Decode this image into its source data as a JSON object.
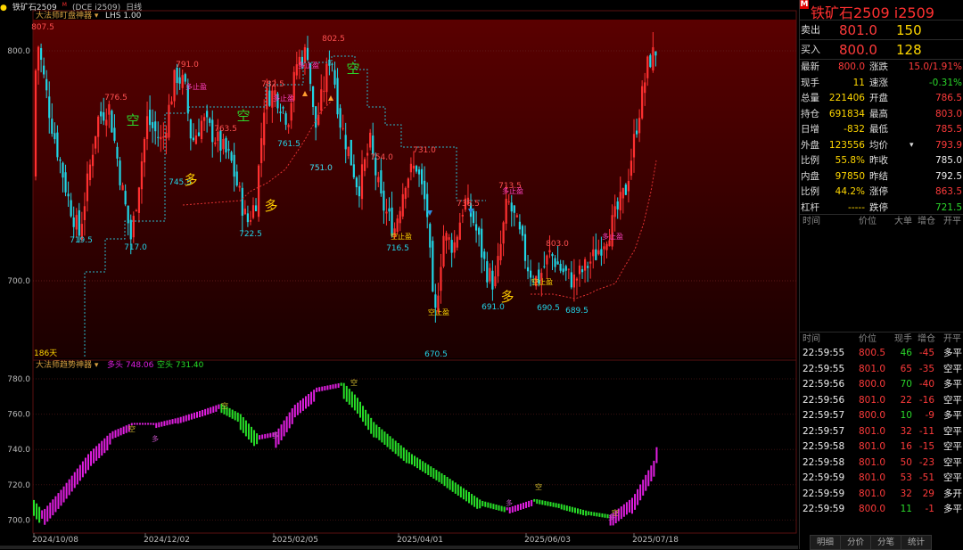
{
  "header": {
    "symbol_label": "铁矿石2509",
    "symbol_sup": "M",
    "code": "(DCE i2509)",
    "period": "日线"
  },
  "main_chart": {
    "indicator": "大法师盯盘神器",
    "extra": "LHS 1.00",
    "y_labels": [
      "800.0",
      "700.0"
    ],
    "annotations": {
      "highs": [
        "807.5",
        "791.0",
        "776.5",
        "763.5",
        "782.5",
        "802.5",
        "751.0",
        "754.0",
        "731.0",
        "738.5",
        "713.5",
        "803.0"
      ],
      "lows": [
        "719.5",
        "717.0",
        "745.5",
        "722.5",
        "761.5",
        "751.0",
        "716.5",
        "670.5",
        "691.0",
        "690.5",
        "689.5"
      ],
      "signals": [
        "空",
        "空",
        "空",
        "多",
        "多",
        "多"
      ],
      "stop_labels": [
        "多止盈",
        "多止盈",
        "多止盈",
        "空止盈",
        "空止盈",
        "空止盈",
        "多止盈",
        "多止盈"
      ],
      "corner": "186天"
    },
    "colors": {
      "up": "#ff3030",
      "down": "#1fd6e6",
      "bg_top": "#5a0000"
    }
  },
  "sub_chart": {
    "indicator": "大法师趋势神器",
    "long_label": "多头",
    "long_value": "748.06",
    "short_label": "空头",
    "short_value": "731.40",
    "y_labels": [
      "780.0",
      "760.0",
      "740.0",
      "720.0",
      "700.0"
    ],
    "marks": [
      "空",
      "多",
      "空",
      "多",
      "空",
      "空",
      "多",
      "空",
      "多"
    ],
    "colors": {
      "long": "#e01ee0",
      "short": "#28e028"
    }
  },
  "x_axis": [
    "2024/10/08",
    "2024/12/02",
    "2025/02/05",
    "2025/04/01",
    "2025/06/03",
    "2025/07/18"
  ],
  "chart_data": {
    "type": "candlestick",
    "title": "铁矿石2509 (DCE i2509) 日线",
    "xlabel": "",
    "ylabel": "",
    "ylim": [
      660,
      815
    ],
    "key_points": [
      {
        "x": "2024/10/08",
        "y": 807.5
      },
      {
        "x": "2024/10 end",
        "y": 719.5
      },
      {
        "x": "2024/11",
        "y": 776.5
      },
      {
        "x": "2024/11",
        "y": 717.0
      },
      {
        "x": "2024/12/02",
        "y": 791.0
      },
      {
        "x": "2024/12",
        "y": 745.5
      },
      {
        "x": "2024/12",
        "y": 763.5
      },
      {
        "x": "2025/01",
        "y": 722.5
      },
      {
        "x": "2025/01",
        "y": 782.5
      },
      {
        "x": "2025/01",
        "y": 761.5
      },
      {
        "x": "2025/02/05",
        "y": 802.5
      },
      {
        "x": "2025/02",
        "y": 751.0
      },
      {
        "x": "2025/03",
        "y": 751.0
      },
      {
        "x": "2025/03",
        "y": 716.5
      },
      {
        "x": "2025/03",
        "y": 754.0
      },
      {
        "x": "2025/04/01",
        "y": 670.5
      },
      {
        "x": "2025/04",
        "y": 731.0
      },
      {
        "x": "2025/05",
        "y": 691.0
      },
      {
        "x": "2025/05",
        "y": 738.5
      },
      {
        "x": "2025/06/03",
        "y": 690.5
      },
      {
        "x": "2025/06",
        "y": 713.5
      },
      {
        "x": "2025/06",
        "y": 689.5
      },
      {
        "x": "2025/07/18",
        "y": 803.0
      }
    ],
    "sub_indicator": {
      "long": 748.06,
      "short": 731.4,
      "ylim": [
        695,
        785
      ]
    }
  },
  "panel": {
    "title": "铁矿石2509  i2509",
    "badge": "M",
    "ask": {
      "label": "卖出",
      "price": "801.0",
      "vol": "150"
    },
    "bid": {
      "label": "买入",
      "price": "800.0",
      "vol": "128"
    },
    "stats": [
      {
        "l1": "最新",
        "v1": "800.0",
        "c1": "red",
        "l2": "涨跌",
        "v2": "15.0/1.91%",
        "c2": "red"
      },
      {
        "l1": "现手",
        "v1": "11",
        "c1": "yellow",
        "l2": "速涨",
        "v2": "-0.31%",
        "c2": "green"
      },
      {
        "l1": "总量",
        "v1": "221406",
        "c1": "yellow",
        "l2": "开盘",
        "v2": "786.5",
        "c2": "red"
      },
      {
        "l1": "持仓",
        "v1": "691834",
        "c1": "yellow",
        "l2": "最高",
        "v2": "803.0",
        "c2": "red"
      },
      {
        "l1": "日增",
        "v1": "-832",
        "c1": "yellow",
        "l2": "最低",
        "v2": "785.5",
        "c2": "red"
      },
      {
        "l1": "外盘",
        "v1": "123556",
        "c1": "yellow",
        "l2": "均价",
        "v2": "793.9",
        "c2": "red"
      },
      {
        "l1": "比例",
        "v1": "55.8%",
        "c1": "yellow",
        "l2": "昨收",
        "v2": "785.0",
        "c2": "white"
      },
      {
        "l1": "内盘",
        "v1": "97850",
        "c1": "yellow",
        "l2": "昨结",
        "v2": "792.5",
        "c2": "white"
      },
      {
        "l1": "比例",
        "v1": "44.2%",
        "c1": "yellow",
        "l2": "涨停",
        "v2": "863.5",
        "c2": "red"
      },
      {
        "l1": "杠杆",
        "v1": "-----",
        "c1": "yellow",
        "l2": "跌停",
        "v2": "721.5",
        "c2": "green"
      }
    ],
    "table_headers": [
      "时间",
      "价位",
      "大单",
      "增仓",
      "开平"
    ],
    "tick_headers": [
      "时间",
      "价位",
      "现手",
      "增仓",
      "开平"
    ],
    "ticks": [
      {
        "time": "22:59:55",
        "price": "800.5",
        "vol": "46",
        "chg": "-45",
        "type": "多平",
        "pc": "red",
        "vc": "green"
      },
      {
        "time": "22:59:55",
        "price": "801.0",
        "vol": "65",
        "chg": "-35",
        "type": "空平",
        "pc": "red",
        "vc": "red"
      },
      {
        "time": "22:59:56",
        "price": "800.0",
        "vol": "70",
        "chg": "-40",
        "type": "多平",
        "pc": "red",
        "vc": "green"
      },
      {
        "time": "22:59:56",
        "price": "801.0",
        "vol": "22",
        "chg": "-16",
        "type": "空平",
        "pc": "red",
        "vc": "red"
      },
      {
        "time": "22:59:57",
        "price": "800.0",
        "vol": "10",
        "chg": "-9",
        "type": "多平",
        "pc": "red",
        "vc": "green"
      },
      {
        "time": "22:59:57",
        "price": "801.0",
        "vol": "32",
        "chg": "-11",
        "type": "空平",
        "pc": "red",
        "vc": "red"
      },
      {
        "time": "22:59:58",
        "price": "801.0",
        "vol": "16",
        "chg": "-15",
        "type": "空平",
        "pc": "red",
        "vc": "red"
      },
      {
        "time": "22:59:58",
        "price": "801.0",
        "vol": "50",
        "chg": "-23",
        "type": "空平",
        "pc": "red",
        "vc": "red"
      },
      {
        "time": "22:59:59",
        "price": "801.0",
        "vol": "53",
        "chg": "-51",
        "type": "空平",
        "pc": "red",
        "vc": "red"
      },
      {
        "time": "22:59:59",
        "price": "801.0",
        "vol": "32",
        "chg": "29",
        "type": "多开",
        "pc": "red",
        "vc": "red"
      },
      {
        "time": "22:59:59",
        "price": "800.0",
        "vol": "11",
        "chg": "-1",
        "type": "多平",
        "pc": "red",
        "vc": "green"
      }
    ],
    "tabs": [
      "明细",
      "分价",
      "分笔",
      "统计"
    ]
  }
}
